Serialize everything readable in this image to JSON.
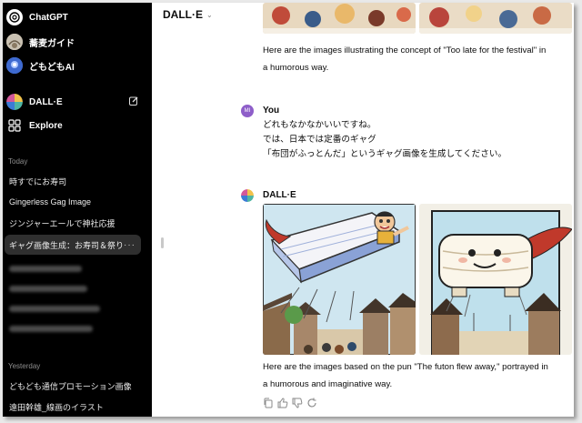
{
  "sidebar": {
    "gpts": [
      {
        "label": "ChatGPT"
      },
      {
        "label": "蕎麦ガイド"
      },
      {
        "label": "どもどもAI"
      }
    ],
    "dalle_label": "DALL·E",
    "explore_label": "Explore",
    "today_label": "Today",
    "today_items": [
      {
        "label": "時すでにお寿司"
      },
      {
        "label": "Gingerless Gag Image"
      },
      {
        "label": "ジンジャーエールで神社応援"
      },
      {
        "label": "ギャグ画像生成：お寿司＆祭り"
      }
    ],
    "more_dots": "···",
    "yesterday_label": "Yesterday",
    "yesterday_items": [
      {
        "label": "どもども通信プロモーション画像"
      },
      {
        "label": "遠田幹雄_線画のイラスト"
      }
    ]
  },
  "header": {
    "title": "DALL·E",
    "chevron": "⌄"
  },
  "conversation": {
    "prev_reply_line1": "Here are the images illustrating the concept of \"Too late for the festival\" in",
    "prev_reply_line2": "a humorous way.",
    "user_author": "You",
    "user_avatar_initials": "MI",
    "user_line1": "どれもなかなかいいですね。",
    "user_line2": "では、日本では定番のギャグ",
    "user_line3": "「布団がふっとんだ」というギャグ画像を生成してください。",
    "assistant_author": "DALL·E",
    "reply_line1": "Here are the images based on the pun \"The futon flew away,\" portrayed in",
    "reply_line2": "a humorous and imaginative way."
  },
  "icons": {
    "edit": "edit-icon",
    "copy": "copy-icon",
    "thumbs_up": "thumbs-up-icon",
    "thumbs_down": "thumbs-down-icon",
    "regenerate": "regenerate-icon"
  },
  "colors": {
    "sidebar_bg": "#000000",
    "active_item_bg": "#2f2f2f",
    "user_avatar": "#8e5ec9"
  }
}
